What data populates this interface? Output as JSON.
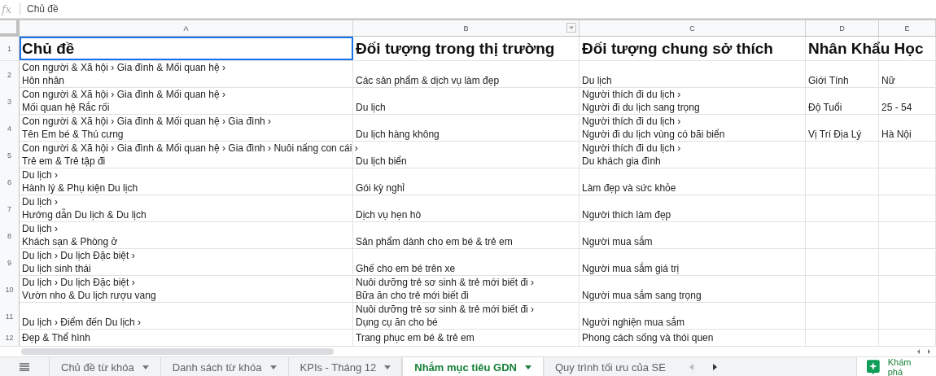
{
  "formula_bar": {
    "label": "fx",
    "value": "Chủ đề"
  },
  "columns": [
    {
      "label": "A",
      "filter": false
    },
    {
      "label": "B",
      "filter": true
    },
    {
      "label": "C",
      "filter": false
    },
    {
      "label": "D",
      "filter": false
    },
    {
      "label": "E",
      "filter": false
    }
  ],
  "rows": [
    {
      "number": "1",
      "kind": "heading",
      "cells": [
        {
          "text": "Chủ đề",
          "selected": true
        },
        {
          "text": "Đối tượng trong thị trường",
          "selected": false
        },
        {
          "text": "Đối tượng chung sở thích",
          "selected": false
        },
        {
          "text": "Nhân Khẩu Học",
          "selected": false
        }
      ]
    },
    {
      "number": "2",
      "kind": "data",
      "cells": [
        {
          "text": "Con người & Xã hội › Gia đình & Mối quan hệ ›\nHôn nhân",
          "selected": false
        },
        {
          "text": "Các sản phẩm & dịch vụ làm đẹp",
          "selected": false
        },
        {
          "text": "Du lịch",
          "selected": false
        },
        {
          "text": "Giới Tính",
          "selected": false
        },
        {
          "text": "Nữ",
          "selected": false
        }
      ]
    },
    {
      "number": "3",
      "kind": "data",
      "cells": [
        {
          "text": "Con người & Xã hội › Gia đình & Mối quan hệ ›\nMối quan hệ Rắc rối",
          "selected": false
        },
        {
          "text": "Du lịch",
          "selected": false
        },
        {
          "text": "Người thích đi du lịch ›\nNgười đi du lịch sang trọng",
          "selected": false
        },
        {
          "text": "Độ Tuổi",
          "selected": false
        },
        {
          "text": "25 - 54",
          "selected": false
        }
      ]
    },
    {
      "number": "4",
      "kind": "data",
      "cells": [
        {
          "text": "Con người & Xã hội › Gia đình & Mối quan hệ › Gia đình ›\nTên Em bé & Thú cưng",
          "selected": false
        },
        {
          "text": "Du lịch hàng không",
          "selected": false
        },
        {
          "text": "Người thích đi du lịch ›\nNgười đi du lịch vùng có bãi biển",
          "selected": false
        },
        {
          "text": "Vị Trí Địa Lý",
          "selected": false
        },
        {
          "text": "Hà Nội",
          "selected": false
        }
      ]
    },
    {
      "number": "5",
      "kind": "data",
      "cells": [
        {
          "text": "Con người & Xã hội › Gia đình & Mối quan hệ › Gia đình › Nuôi nấng con cái ›\nTrẻ em & Trẻ tập đi",
          "selected": false
        },
        {
          "text": "Du lịch biển",
          "selected": false
        },
        {
          "text": "Người thích đi du lịch ›\nDu khách gia đình",
          "selected": false
        }
      ]
    },
    {
      "number": "6",
      "kind": "data",
      "cells": [
        {
          "text": "Du lịch ›\nHành lý & Phụ kiện Du lịch",
          "selected": false
        },
        {
          "text": "Gói kỳ nghỉ",
          "selected": false
        },
        {
          "text": "Làm đẹp và sức khỏe",
          "selected": false
        }
      ]
    },
    {
      "number": "7",
      "kind": "data",
      "cells": [
        {
          "text": "Du lịch ›\nHướng dẫn Du lịch & Du lịch",
          "selected": false
        },
        {
          "text": "Dịch vụ hẹn hò",
          "selected": false
        },
        {
          "text": "Người thích làm đẹp",
          "selected": false
        }
      ]
    },
    {
      "number": "8",
      "kind": "data",
      "cells": [
        {
          "text": "Du lịch ›\nKhách sạn & Phòng ở",
          "selected": false
        },
        {
          "text": "Sản phẩm dành cho em bé & trẻ em",
          "selected": false
        },
        {
          "text": "Người mua sắm",
          "selected": false
        }
      ]
    },
    {
      "number": "9",
      "kind": "data",
      "cells": [
        {
          "text": "Du lịch › Du lịch Đặc biệt ›\nDu lịch sinh thái",
          "selected": false
        },
        {
          "text": "Ghế cho em bé trên xe",
          "selected": false
        },
        {
          "text": "Người mua sắm giá trị",
          "selected": false
        }
      ]
    },
    {
      "number": "10",
      "kind": "data",
      "cells": [
        {
          "text": "Du lịch › Du lịch Đặc biệt ›\nVườn nho & Du lịch rượu vang",
          "selected": false
        },
        {
          "text": "Nuôi dưỡng trẻ sơ sinh & trẻ mới biết đi ›\nBữa ăn cho trẻ mới biết đi",
          "selected": false
        },
        {
          "text": "Người mua sắm sang trọng",
          "selected": false
        }
      ]
    },
    {
      "number": "11",
      "kind": "data",
      "cells": [
        {
          "text": "Du lịch › Điểm đến Du lịch ›",
          "selected": false
        },
        {
          "text": "Nuôi dưỡng trẻ sơ sinh & trẻ mới biết đi ›\nDụng cụ ăn cho bé",
          "selected": false
        },
        {
          "text": "Người nghiện mua sắm",
          "selected": false
        }
      ]
    },
    {
      "number": "12",
      "kind": "short",
      "cells": [
        {
          "text": "Đẹp & Thể hình",
          "selected": false
        },
        {
          "text": "Trang phục em bé & trẻ em",
          "selected": false
        },
        {
          "text": "Phong cách sống và thói quen",
          "selected": false
        }
      ]
    }
  ],
  "sheet_tabs": [
    {
      "label": "Chủ đề từ khóa",
      "selected": false
    },
    {
      "label": "Danh sách từ khóa",
      "selected": false
    },
    {
      "label": "KPIs - Tháng 12",
      "selected": false
    },
    {
      "label": "Nhắm mục tiêu GDN",
      "selected": true
    },
    {
      "label": "Quy trình tối ưu của SE",
      "selected": false
    }
  ],
  "explore_button": {
    "label": "Khám phá"
  }
}
